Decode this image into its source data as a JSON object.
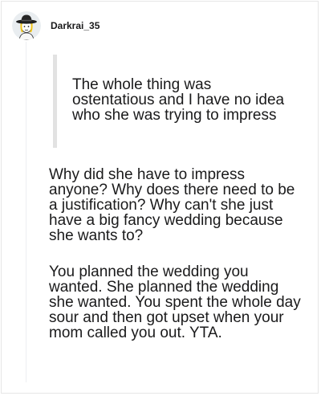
{
  "comment": {
    "username": "Darkrai_35",
    "quote": "The whole thing was ostentatious and I have no idea who she was trying to impress",
    "paragraphs": [
      "Why did she have to impress anyone? Why does there need to be a justification? Why can't she just have a big fancy wedding because she wants to?",
      "You planned the wedding you wanted. She planned the wedding she wanted. You spent the whole day sour and then got upset when your mom called you out. YTA."
    ]
  },
  "colors": {
    "text": "#1a1a1b",
    "quote_bar": "#e2e2e2",
    "thread_line": "#edeff1",
    "border": "#e6e6e6"
  },
  "icons": {
    "avatar": "avatar-cowboy-hat-icon"
  }
}
